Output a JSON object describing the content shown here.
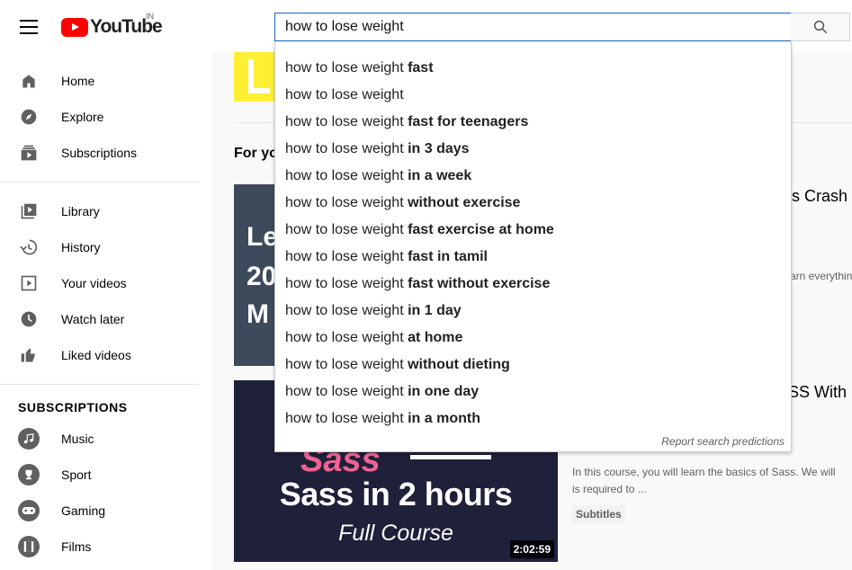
{
  "header": {
    "logo_text": "YouTube",
    "country_code": "IN",
    "search_value": "how to lose weight"
  },
  "sidebar": {
    "primary": [
      {
        "label": "Home",
        "icon": "home-icon"
      },
      {
        "label": "Explore",
        "icon": "compass-icon"
      },
      {
        "label": "Subscriptions",
        "icon": "subscriptions-icon"
      }
    ],
    "library": [
      {
        "label": "Library",
        "icon": "library-icon"
      },
      {
        "label": "History",
        "icon": "history-icon"
      },
      {
        "label": "Your videos",
        "icon": "your-videos-icon"
      },
      {
        "label": "Watch later",
        "icon": "clock-icon"
      },
      {
        "label": "Liked videos",
        "icon": "thumbs-up-icon"
      }
    ],
    "subscriptions_title": "SUBSCRIPTIONS",
    "subscriptions": [
      {
        "label": "Music",
        "icon": "music-note-icon"
      },
      {
        "label": "Sport",
        "icon": "trophy-icon"
      },
      {
        "label": "Gaming",
        "icon": "gamepad-icon"
      },
      {
        "label": "Films",
        "icon": "film-icon"
      }
    ]
  },
  "suggestions": {
    "prefix": "how to lose weight",
    "items": [
      {
        "suffix": "fast"
      },
      {
        "suffix": ""
      },
      {
        "suffix": "fast for teenagers"
      },
      {
        "suffix": "in 3 days"
      },
      {
        "suffix": "in a week"
      },
      {
        "suffix": "without exercise"
      },
      {
        "suffix": "fast exercise at home"
      },
      {
        "suffix": "fast in tamil"
      },
      {
        "suffix": "fast without exercise"
      },
      {
        "suffix": "in 1 day"
      },
      {
        "suffix": "at home"
      },
      {
        "suffix": "without dieting"
      },
      {
        "suffix": "in one day"
      },
      {
        "suffix": "in a month"
      }
    ],
    "report_label": "Report search predictions"
  },
  "main": {
    "section_title": "For yo",
    "video1": {
      "thumb_lines": [
        "Le",
        "20",
        "M"
      ],
      "title_fragment": "s Crash C",
      "desc_fragment": "arn everythin"
    },
    "video2": {
      "thumb_pink": "Sass",
      "thumb_title": "Sass in 2 hours",
      "thumb_subtitle": "Full Course",
      "duration": "2:02:59",
      "title_fragment": "SS With S",
      "desc_line1": "In this course, you will learn the basics of Sass. We will",
      "desc_line2": "is required to ...",
      "badge": "Subtitles"
    }
  }
}
